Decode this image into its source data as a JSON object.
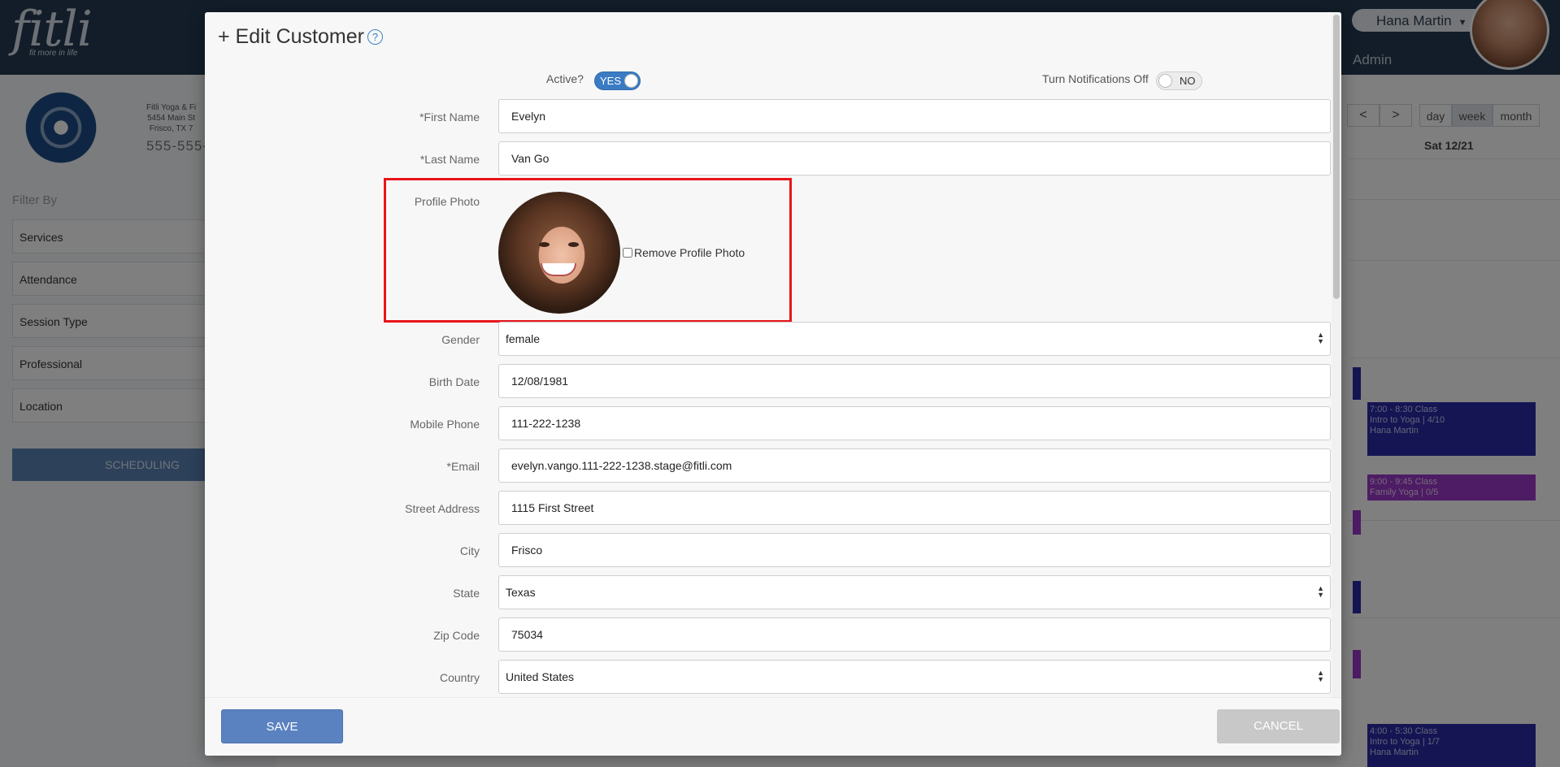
{
  "app": {
    "logo_text": "fitli",
    "logo_tagline": "fit more in life",
    "user_name": "Hana Martin",
    "admin_label": "Admin",
    "business_lines": [
      "Fitli Yoga & Fi",
      "5454 Main St",
      "Frisco, TX 7"
    ],
    "business_phone": "555-555-",
    "filter_by": "Filter By",
    "filters": [
      "Services",
      "Attendance",
      "Session Type",
      "Professional",
      "Location"
    ],
    "scheduling_button": "SCHEDULING",
    "calendar": {
      "prev": "<",
      "next": ">",
      "views": [
        "day",
        "week",
        "month"
      ],
      "active_view": "week",
      "day_header": "Sat 12/21",
      "events": [
        {
          "time": "7:00 - 8:30",
          "type": "Class",
          "title": "Intro to Yoga | 4/10",
          "instructor": "Hana Martin",
          "color": "#2a2ba8"
        },
        {
          "time": "9:00 - 9:45",
          "type": "Class",
          "title": "Family Yoga | 0/5",
          "instructor": "",
          "color": "#9b38c9"
        },
        {
          "time": "4:00 - 5:30",
          "type": "Class",
          "title": "Intro to Yoga | 1/7",
          "instructor": "Hana Martin",
          "color": "#2a2ba8"
        }
      ]
    }
  },
  "modal": {
    "title": "+ Edit Customer",
    "help_icon": "?",
    "active_label": "Active?",
    "active_value": "YES",
    "notifications_label": "Turn Notifications Off",
    "notifications_value": "NO",
    "fields": {
      "first_name": {
        "label": "*First Name",
        "value": "Evelyn"
      },
      "last_name": {
        "label": "*Last Name",
        "value": "Van Go"
      },
      "profile_photo": {
        "label": "Profile Photo",
        "remove_label": "Remove Profile Photo",
        "remove_checked": false
      },
      "gender": {
        "label": "Gender",
        "value": "female"
      },
      "birth_date": {
        "label": "Birth Date",
        "value": "12/08/1981"
      },
      "mobile_phone": {
        "label": "Mobile Phone",
        "value": "111-222-1238"
      },
      "email": {
        "label": "*Email",
        "value": "evelyn.vango.111-222-1238.stage@fitli.com"
      },
      "street_address": {
        "label": "Street Address",
        "value": "1115 First Street"
      },
      "city": {
        "label": "City",
        "value": "Frisco"
      },
      "state": {
        "label": "State",
        "value": "Texas"
      },
      "zip_code": {
        "label": "Zip Code",
        "value": "75034"
      },
      "country": {
        "label": "Country",
        "value": "United States"
      }
    },
    "save_label": "SAVE",
    "cancel_label": "CANCEL"
  },
  "colors": {
    "topbar": "#243a52",
    "accent": "#3a7cc4",
    "save_button": "#5a82c0",
    "cancel_button": "#c8c8c8",
    "highlight": "#e8141a"
  }
}
